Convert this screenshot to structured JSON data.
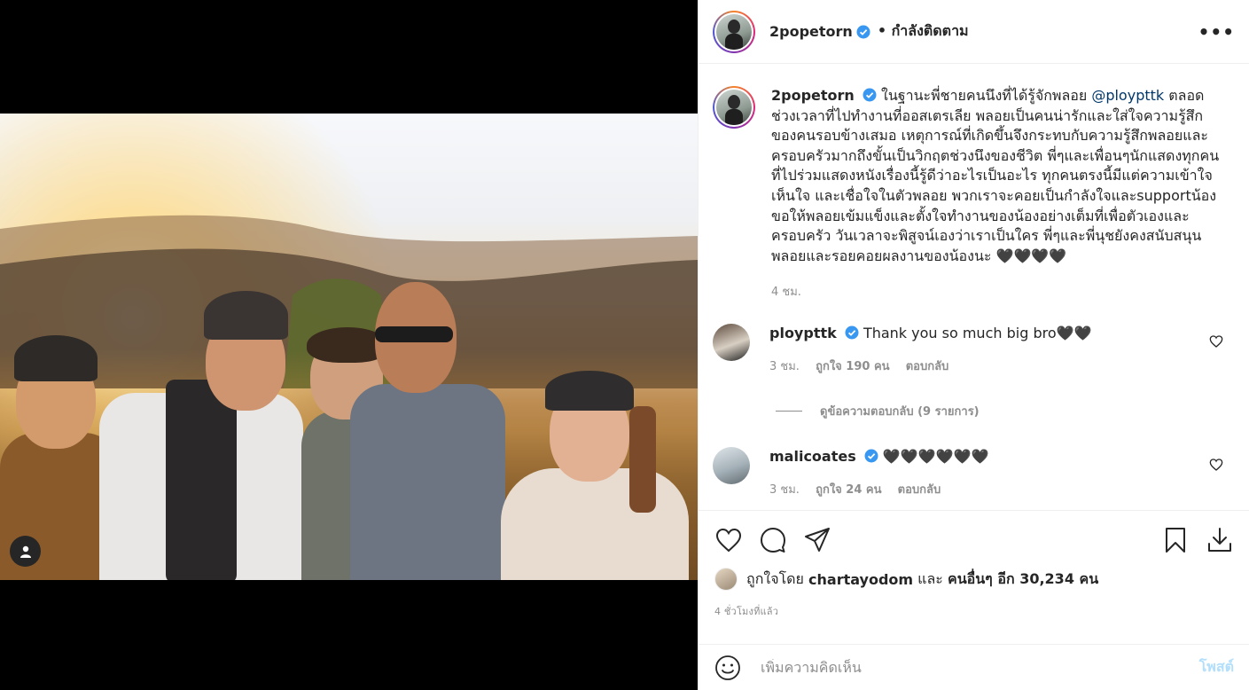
{
  "post": {
    "username": "2popetorn",
    "follow_status": "• กำลังติดตาม",
    "more_icon": "more-horizontal-icon"
  },
  "caption": {
    "username": "2popetorn",
    "text_before": "ในฐานะพี่ชายคนนึงที่ได้รู้จักพลอย",
    "mention": "@ploypttk",
    "text_after": "ตลอดช่วงเวลาที่ไปทำงานที่ออสเตรเลีย พลอยเป็นคนน่ารักและใส่ใจความรู้สึกของคนรอบข้างเสมอ เหตุการณ์ที่เกิดขึ้นจึงกระทบกับความรู้สึกพลอยและครอบครัวมากถึงขั้นเป็นวิกฤตช่วงนึงของชีวิต พี่ๆและเพื่อนๆนักแสดงทุกคนที่ไปร่วมแสดงหนังเรื่องนี้รู้ดีว่าอะไรเป็นอะไร ทุกคนตรงนี้มีแต่ความเข้าใจ เห็นใจ และเชื่อใจในตัวพลอย พวกเราจะคอยเป็นกำลังใจและsupportน้อง ขอให้พลอยเข้มแข็งและตั้งใจทำงานของน้องอย่างเต็มที่เพื่อตัวเองและครอบครัว วันเวลาจะพิสูจน์เองว่าเราเป็นใคร พี่ๆและพี่นุชยังคงสนับสนุนพลอยและรอยคอยผลงานของน้องนะ 🖤🖤🖤🖤",
    "time": "4 ชม."
  },
  "comments": [
    {
      "username": "ploypttk",
      "text": "Thank you so much big bro🖤🖤",
      "time": "3 ชม.",
      "likes": "ถูกใจ 190 คน",
      "reply": "ตอบกลับ"
    },
    {
      "username": "malicoates",
      "text": "🖤🖤🖤🖤🖤🖤",
      "time": "3 ชม.",
      "likes": "ถูกใจ 24 คน",
      "reply": "ตอบกลับ"
    }
  ],
  "view_replies": "ดูข้อความตอบกลับ (9 รายการ)",
  "likes": {
    "prefix": "ถูกใจโดย",
    "user": "chartayodom",
    "middle": "และ",
    "others": "คนอื่นๆ อีก 30,234 คน"
  },
  "timestamp": "4 ชั่วโมงที่แล้ว",
  "add_comment": {
    "placeholder": "เพิ่มความคิดเห็น",
    "post_label": "โพสต์"
  },
  "colors": {
    "verified": "#3897f0",
    "link": "#00376b",
    "muted": "#8e8e8e",
    "post_disabled": "#b2dffc"
  }
}
